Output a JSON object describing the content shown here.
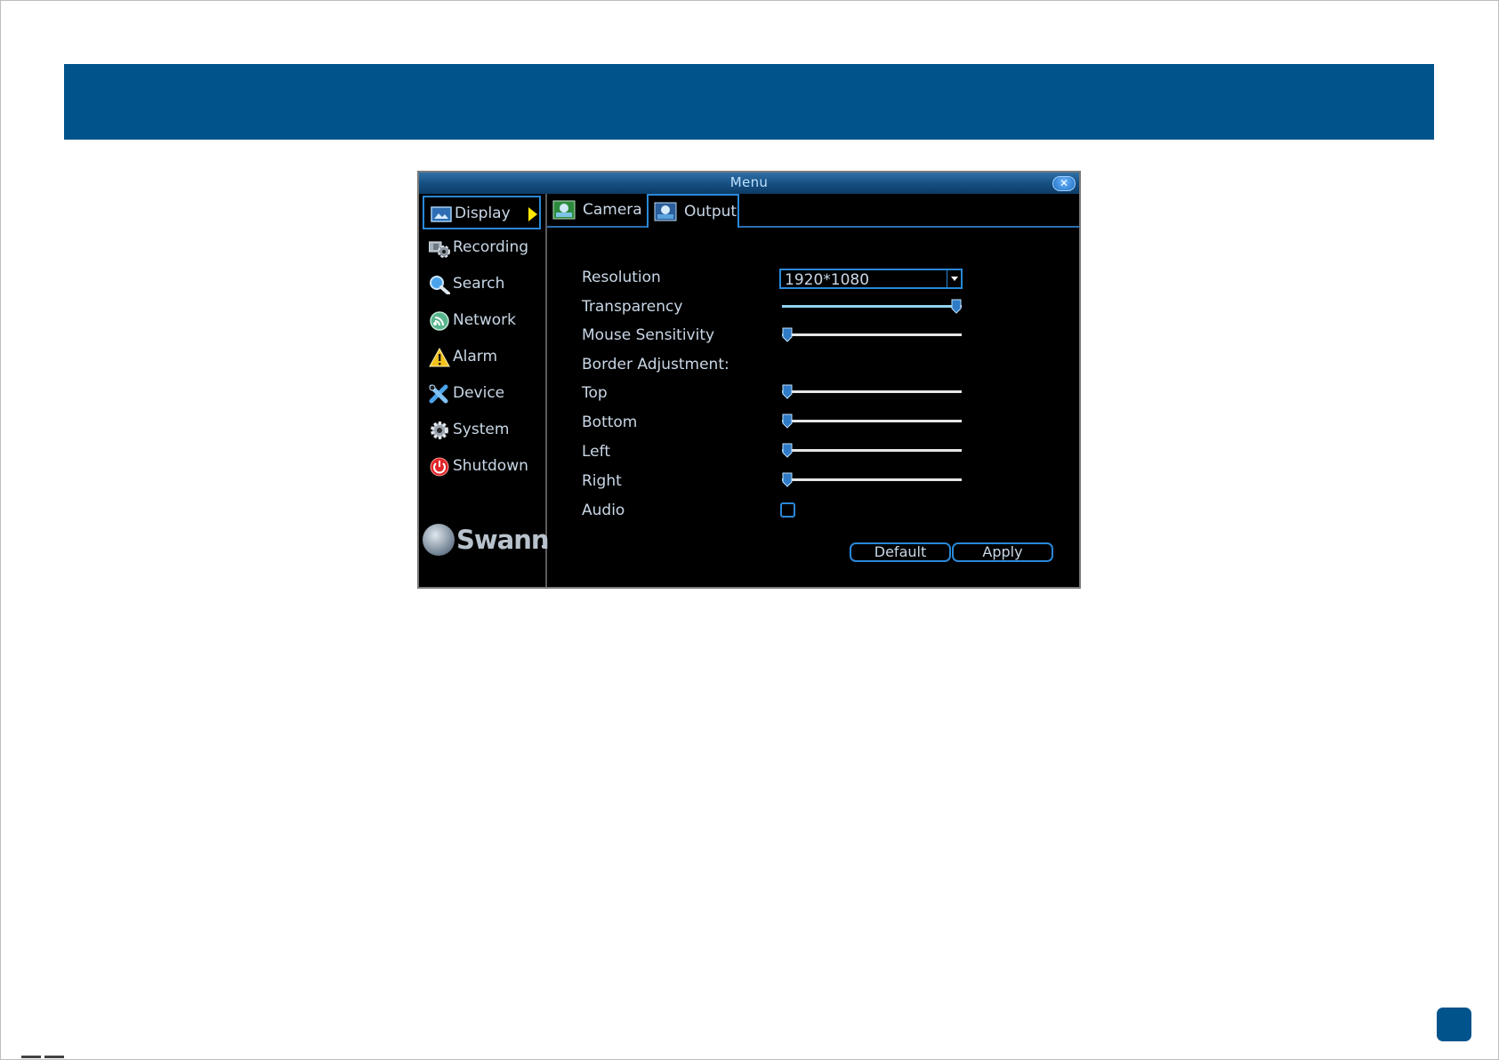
{
  "window": {
    "title": "Menu",
    "close_icon": "close-icon"
  },
  "sidebar": {
    "items": [
      {
        "label": "Display",
        "icon": "display-icon",
        "active": true
      },
      {
        "label": "Recording",
        "icon": "recording-icon"
      },
      {
        "label": "Search",
        "icon": "search-icon"
      },
      {
        "label": "Network",
        "icon": "network-icon"
      },
      {
        "label": "Alarm",
        "icon": "alarm-icon"
      },
      {
        "label": "Device",
        "icon": "device-icon"
      },
      {
        "label": "System",
        "icon": "system-icon"
      },
      {
        "label": "Shutdown",
        "icon": "shutdown-icon"
      }
    ],
    "logo_text": "Swann"
  },
  "tabs": [
    {
      "label": "Camera",
      "icon": "camera-tab-icon",
      "active": false
    },
    {
      "label": "Output",
      "icon": "output-tab-icon",
      "active": true
    }
  ],
  "form": {
    "resolution": {
      "label": "Resolution",
      "value": "1920*1080"
    },
    "transparency": {
      "label": "Transparency",
      "level": 1.0
    },
    "mouse_sensitivity": {
      "label": "Mouse Sensitivity",
      "level": 0.0
    },
    "border_adjustment": {
      "label": "Border Adjustment:"
    },
    "top": {
      "label": "Top",
      "level": 0.0
    },
    "bottom": {
      "label": "Bottom",
      "level": 0.0
    },
    "left": {
      "label": "Left",
      "level": 0.0
    },
    "right": {
      "label": "Right",
      "level": 0.0
    },
    "audio": {
      "label": "Audio",
      "checked": false
    }
  },
  "buttons": {
    "default_label": "Default",
    "apply_label": "Apply"
  },
  "colors": {
    "header_band": "#00538b",
    "accent": "#2a88d8",
    "active_arrow": "#ffe600"
  }
}
